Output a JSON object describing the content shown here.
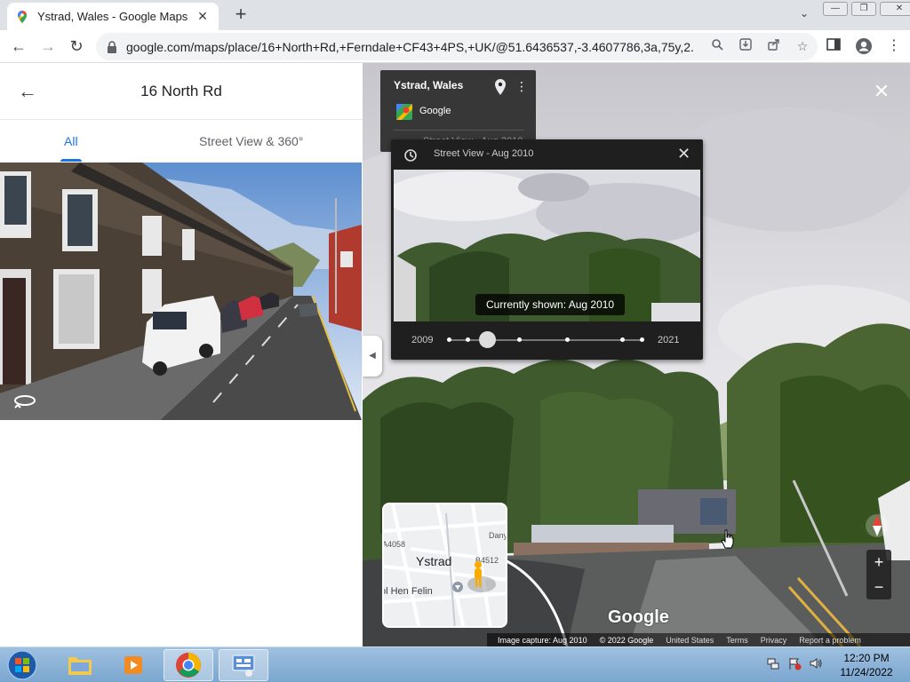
{
  "browser": {
    "tab_title": "Ystrad, Wales - Google Maps",
    "url": "google.com/maps/place/16+North+Rd,+Ferndale+CF43+4PS,+UK/@51.6436537,-3.4607786,3a,75y,2..."
  },
  "left_panel": {
    "title": "16 North Rd",
    "tabs": [
      {
        "label": "All"
      },
      {
        "label": "Street View & 360°"
      }
    ]
  },
  "street_view": {
    "info_card": {
      "place": "Ystrad, Wales",
      "provider": "Google",
      "subtitle": "Street View - Aug 2010"
    },
    "time_machine": {
      "header": "Street View - Aug 2010",
      "tooltip": "Currently shown: Aug 2010",
      "start_year": "2009",
      "end_year": "2021",
      "selected_position": 0.2
    },
    "minimap": {
      "town": "Ystrad",
      "place2": "ol Hen Felin",
      "road1": "A4058",
      "road2": "B4512",
      "road3": "Danyg"
    },
    "logo": "Google",
    "footer": {
      "capture": "Image capture: Aug 2010",
      "copyright": "© 2022 Google",
      "country": "United States",
      "terms": "Terms",
      "privacy": "Privacy",
      "report": "Report a problem"
    },
    "zoom_in": "+",
    "zoom_out": "−"
  },
  "taskbar": {
    "time": "12:20 PM",
    "date": "11/24/2022"
  },
  "colors": {
    "accent": "#1a73e8",
    "panel_dark": "#1f1f1f",
    "taskbar": "#8fb3d9"
  }
}
